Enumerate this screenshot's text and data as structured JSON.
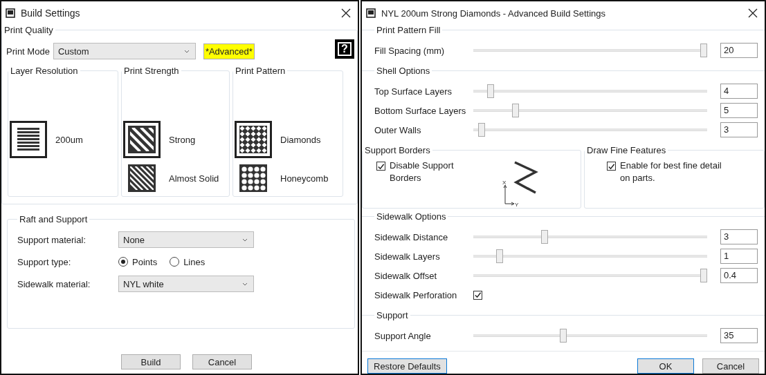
{
  "build_settings": {
    "title": "Build Settings",
    "print_quality": {
      "title": "Print Quality",
      "print_mode_label": "Print Mode",
      "print_mode": "Custom",
      "advanced_badge": "*Advanced*",
      "help": "?",
      "groups": [
        {
          "title": "Layer Resolution",
          "options": [
            {
              "label": "200um",
              "kind": "layers",
              "selected": true
            }
          ]
        },
        {
          "title": "Print Strength",
          "options": [
            {
              "label": "Strong",
              "kind": "stripes",
              "selected": true
            },
            {
              "label": "Almost Solid",
              "kind": "dense-stripes",
              "selected": false
            }
          ]
        },
        {
          "title": "Print Pattern",
          "options": [
            {
              "label": "Diamonds",
              "kind": "diamonds",
              "selected": true
            },
            {
              "label": "Honeycomb",
              "kind": "honeycomb",
              "selected": false
            }
          ]
        }
      ]
    },
    "raft_and_support": {
      "title": "Raft and Support",
      "support_material_label": "Support material:",
      "support_material": "None",
      "support_type_label": "Support type:",
      "support_types": [
        {
          "label": "Points",
          "selected": true
        },
        {
          "label": "Lines",
          "selected": false
        }
      ],
      "sidewalk_material_label": "Sidewalk material:",
      "sidewalk_material": "NYL white"
    },
    "buttons": [
      "Build",
      "Cancel"
    ]
  },
  "advanced": {
    "title": "NYL 200um Strong Diamonds - Advanced Build Settings",
    "sections": [
      {
        "kind": "rows",
        "title": "Print Pattern Fill",
        "rows": [
          {
            "kind": "slider",
            "label": "Fill Spacing (mm)",
            "level": 1.0,
            "value": "20"
          }
        ]
      },
      {
        "kind": "rows",
        "title": "Shell Options",
        "rows": [
          {
            "kind": "slider",
            "label": "Top Surface Layers",
            "level": 0.06,
            "value": "4"
          },
          {
            "kind": "slider",
            "label": "Bottom Surface Layers",
            "level": 0.17,
            "value": "5"
          },
          {
            "kind": "slider",
            "label": "Outer Walls",
            "level": 0.02,
            "value": "3"
          }
        ]
      },
      {
        "kind": "features",
        "groups": [
          {
            "title": "Support Borders",
            "checkbox": {
              "label": "Disable Support Borders",
              "checked": true
            },
            "diagram": {
              "x_label": "X",
              "y_label": "Y"
            }
          },
          {
            "title": "Draw Fine Features",
            "checkbox": {
              "label": "Enable for best fine detail on parts.",
              "checked": true
            }
          }
        ]
      },
      {
        "kind": "rows",
        "title": "Sidewalk Options",
        "rows": [
          {
            "kind": "slider",
            "label": "Sidewalk Distance",
            "level": 0.3,
            "value": "3"
          },
          {
            "kind": "slider",
            "label": "Sidewalk  Layers",
            "level": 0.1,
            "value": "1"
          },
          {
            "kind": "slider",
            "label": "Sidewalk Offset",
            "level": 1.0,
            "value": "0.4"
          },
          {
            "kind": "checkbox",
            "label": "Sidewalk Perforation",
            "checked": true
          }
        ]
      },
      {
        "kind": "rows",
        "title": "Support",
        "rows": [
          {
            "kind": "slider",
            "label": "Support Angle",
            "level": 0.38,
            "value": "35"
          }
        ]
      }
    ],
    "restore_button": {
      "label": "Restore Defaults",
      "highlighted": true
    },
    "buttons": [
      {
        "label": "OK",
        "highlighted": true
      },
      {
        "label": "Cancel",
        "highlighted": false
      }
    ]
  }
}
